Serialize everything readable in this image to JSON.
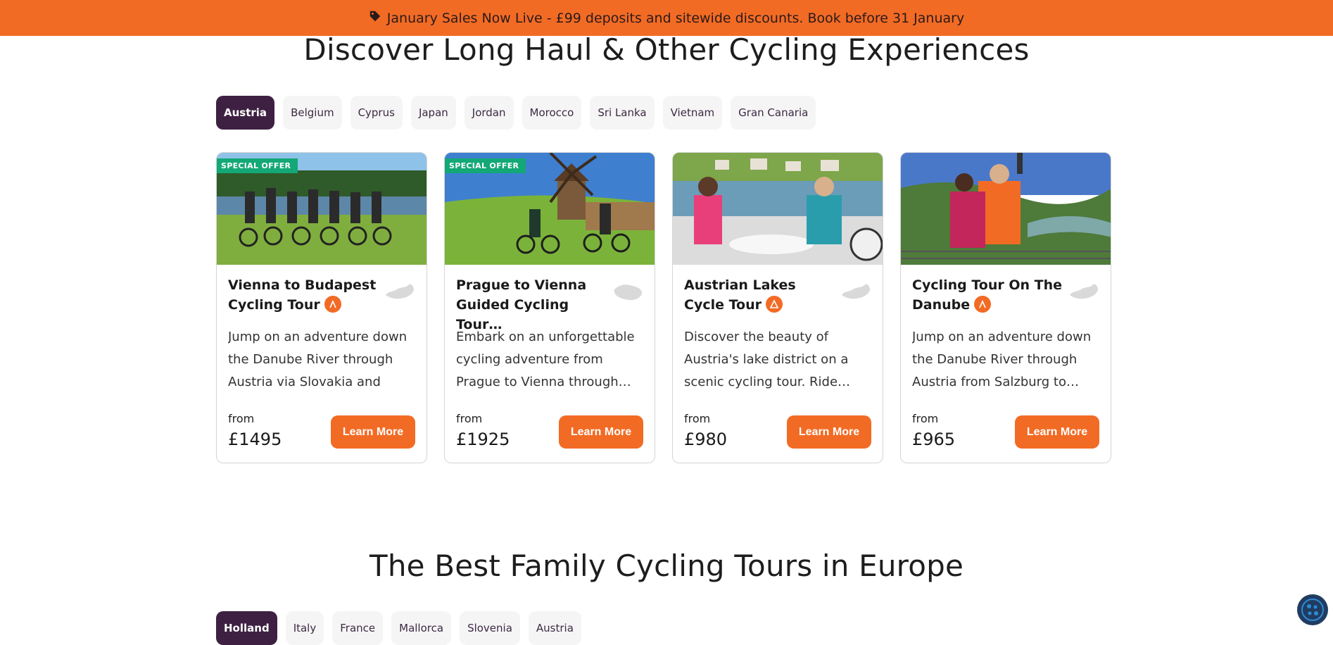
{
  "banner": {
    "text": "January Sales Now Live - £99 deposits and sitewide discounts. Book before 31 January",
    "icon": "tag-icon"
  },
  "section1": {
    "title": "Discover Long Haul & Other Cycling Experiences",
    "tabs": [
      "Austria",
      "Belgium",
      "Cyprus",
      "Japan",
      "Jordan",
      "Morocco",
      "Sri Lanka",
      "Vietnam",
      "Gran Canaria"
    ],
    "active_tab": "Austria"
  },
  "cards": [
    {
      "badge": "SPECIAL OFFER",
      "title": "Vienna to Budapest Cycling Tour",
      "description": "Jump on an adventure down the Danube River through Austria via Slovakia and into…",
      "from_label": "from",
      "price": "£1495",
      "button": "Learn More"
    },
    {
      "badge": "SPECIAL OFFER",
      "title": "Prague to Vienna Guided Cycling Tour…",
      "description": "Embark on an unforgettable cycling adventure from Prague to Vienna through…",
      "from_label": "from",
      "price": "£1925",
      "button": "Learn More"
    },
    {
      "badge": "",
      "title": "Austrian Lakes Cycle Tour",
      "description": "Discover the beauty of Austria's lake district on a scenic cycling tour. Ride…",
      "from_label": "from",
      "price": "£980",
      "button": "Learn More"
    },
    {
      "badge": "",
      "title": "Cycling Tour On The Danube",
      "description": "Jump on an adventure down the Danube River through Austria from Salzburg to…",
      "from_label": "from",
      "price": "£965",
      "button": "Learn More"
    }
  ],
  "section2": {
    "title": "The Best Family Cycling Tours in Europe",
    "tabs": [
      "Holland",
      "Italy",
      "France",
      "Mallorca",
      "Slovenia",
      "Austria"
    ],
    "active_tab": "Holland"
  },
  "colors": {
    "accent": "#f26b24",
    "active_tab": "#3e2142",
    "badge": "#13a876"
  }
}
